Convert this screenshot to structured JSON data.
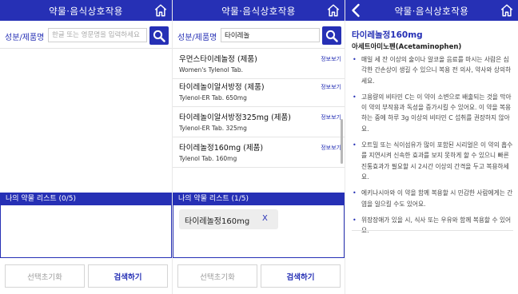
{
  "colors": {
    "primary": "#2630b5",
    "border": "#d5d5d5",
    "chip_bg": "#ededed"
  },
  "icons": {
    "home": "home-icon",
    "search": "search-icon",
    "back": "back-arrow-icon",
    "remove": "close-icon"
  },
  "screen1": {
    "title": "약물·음식상호작용",
    "search_label": "성분/제품명",
    "search_placeholder": "한글 또는 영문명을 입력하세요",
    "search_value": "",
    "list_header": "나의 약물 리스트 (0/5)",
    "btn_reset": "선택초기화",
    "btn_search": "검색하기"
  },
  "screen2": {
    "title": "약물·음식상호작용",
    "search_label": "성분/제품명",
    "search_placeholder": "한글 또는 영문명을 입력하세요",
    "search_value": "타이레놀",
    "results": [
      {
        "name": "우먼스타이레놀정 (제품)",
        "sub": "Women's Tylenol Tab.",
        "info": "정보보기"
      },
      {
        "name": "타이레놀이알서방정 (제품)",
        "sub": "Tylenol-ER Tab. 650mg",
        "info": "정보보기"
      },
      {
        "name": "타이레놀이알서방정325mg (제품)",
        "sub": "Tylenol-ER Tab. 325mg",
        "info": "정보보기"
      },
      {
        "name": "타이레놀정160mg (제품)",
        "sub": "Tylenol Tab. 160mg",
        "info": "정보보기"
      }
    ],
    "list_header": "나의 약물 리스트 (1/5)",
    "my_list": [
      {
        "name": "타이레놀정160mg",
        "remove": "X"
      }
    ],
    "btn_reset": "선택초기화",
    "btn_search": "검색하기"
  },
  "screen3": {
    "title": "약물·음식상호작용",
    "drug_title": "타이레놀정160mg",
    "ingredient": "아세트아미노펜(Acetaminophen)",
    "bullet_char": "•",
    "items": [
      "매일 세 잔 이상의 술이나 알코올 음료를 마시는 사람은 심각한 간손상이 생길 수 있으니 복용 전 의사, 약사와 상의하세요.",
      "고용량의 비타민 C는 이 약이 소변으로 배출되는 것을 막아 이 약의 부작용과 독성을 증가시킬 수 있어요. 이 약을 복용하는 중에 하루 3g 이상의 비타민 C 섭취를 권장하지 않아요.",
      "오트밀 또는 식이섬유가 많이 포함된 시리얼은 이 약의 흡수를 지연시켜 신속한 효과를 보지 못하게 할 수 있으니 빠른 진통효과가 필요할 시 2시간 이상의 간격을 두고 복용하세요.",
      "에키나시아와 이 약을 함께 복용할 시 민감한 사람에게는 간염을 일으킬 수도 있어요.",
      "위장장애가 있을 시, 식사 또는 우유와 함께 복용할 수 있어요."
    ]
  }
}
